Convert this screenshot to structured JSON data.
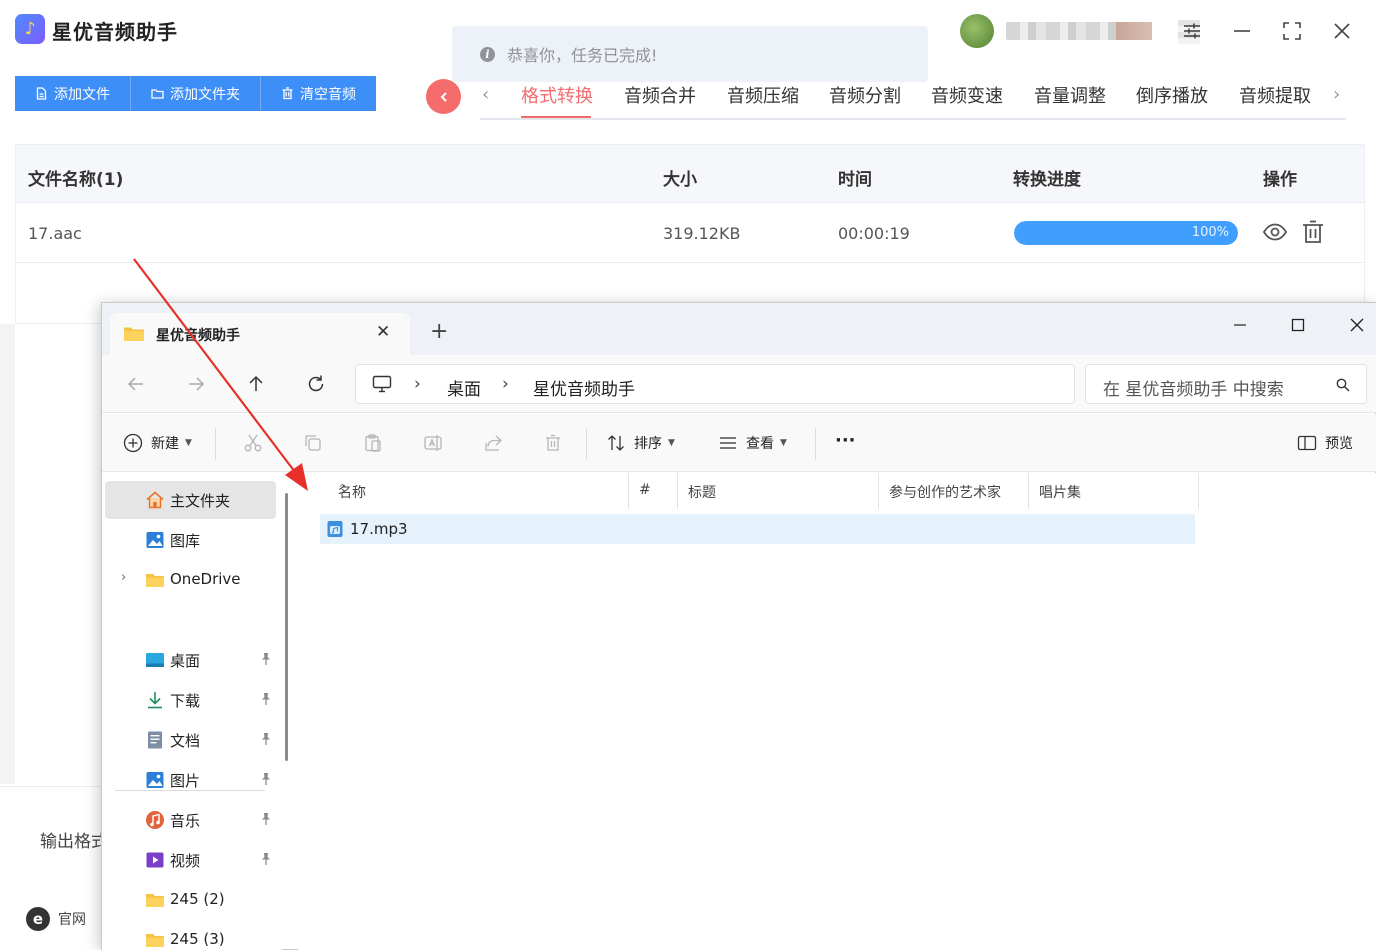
{
  "app": {
    "title": "星优音频助手",
    "logo_glyph": "♪",
    "toast": {
      "message": "恭喜你，任务已完成!",
      "icon": "info-icon"
    },
    "toolbar": {
      "add_file": "添加文件",
      "add_folder": "添加文件夹",
      "clear_audio": "清空音频"
    },
    "tabs": [
      "格式转换",
      "音频合并",
      "音频压缩",
      "音频分割",
      "音频变速",
      "音量调整",
      "倒序播放",
      "音频提取"
    ],
    "active_tab": "格式转换",
    "accent_color": "#f56c6c",
    "button_color": "#3e8ef7",
    "table": {
      "headers": {
        "name": "文件名称(1)",
        "size": "大小",
        "time": "时间",
        "progress": "转换进度",
        "actions": "操作"
      },
      "rows": [
        {
          "name": "17.aac",
          "size": "319.12KB",
          "time": "00:00:19",
          "progress_label": "100%",
          "progress": 100
        }
      ]
    },
    "output_label": "输出格式",
    "website_label": "官网"
  },
  "explorer": {
    "tab_title": "星优音频助手",
    "breadcrumb": [
      "桌面",
      "星优音频助手"
    ],
    "search_placeholder": "在 星优音频助手 中搜索",
    "commands": {
      "new": "新建",
      "sort": "排序",
      "view": "查看",
      "more": "···",
      "preview": "预览"
    },
    "sidebar": {
      "home": "主文件夹",
      "gallery": "图库",
      "onedrive": "OneDrive",
      "quick": [
        {
          "label": "桌面",
          "icon": "desktop-icon"
        },
        {
          "label": "下载",
          "icon": "download-icon"
        },
        {
          "label": "文档",
          "icon": "document-icon"
        },
        {
          "label": "图片",
          "icon": "picture-icon"
        },
        {
          "label": "音乐",
          "icon": "music-icon"
        },
        {
          "label": "视频",
          "icon": "video-icon"
        },
        {
          "label": "245 (2)",
          "icon": "folder-icon"
        },
        {
          "label": "245 (3)",
          "icon": "folder-icon"
        }
      ]
    },
    "columns": {
      "name": "名称",
      "number": "#",
      "title": "标题",
      "artist": "参与创作的艺术家",
      "album": "唱片集"
    },
    "files": [
      {
        "name": "17.mp3",
        "icon": "audio-file-icon"
      }
    ]
  }
}
